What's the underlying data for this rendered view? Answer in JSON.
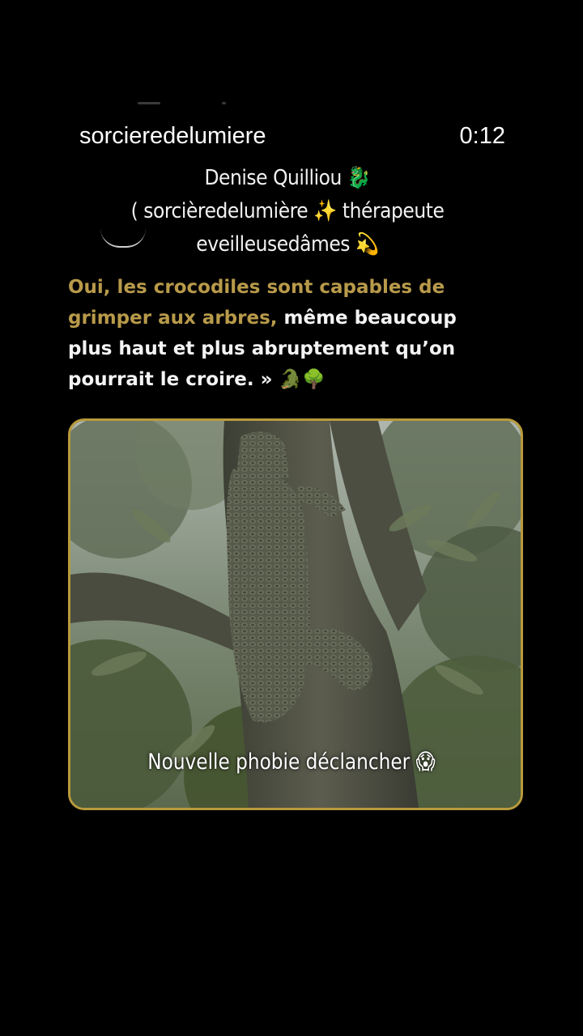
{
  "header": {
    "username": "sorcieredelumiere",
    "timer": "0:12"
  },
  "author": {
    "line1": "Denise Quilliou 🐉",
    "line2": "( sorcièredelumière ✨ thérapeute",
    "line3": "eveilleusedâmes 💫"
  },
  "quote": {
    "gold_part": "Oui, les crocodiles sont capables de grimper aux arbres,",
    "white_part": " même beaucoup plus haut et plus abruptement qu’on pourrait le croire. » 🐊🌳"
  },
  "caption": "Nouvelle phobie déclancher 😱",
  "colors": {
    "background": "#000000",
    "gold_text": "#b89a4a",
    "frame_border": "#b89a3c"
  }
}
